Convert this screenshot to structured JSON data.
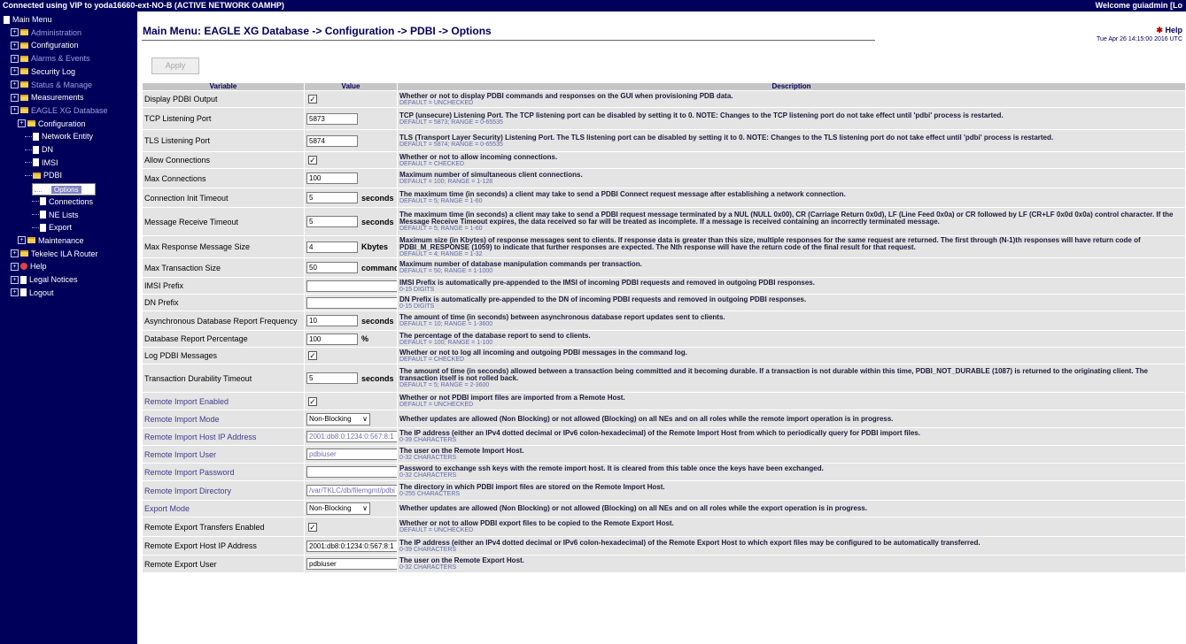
{
  "topbar": {
    "connection": "Connected using VIP to yoda16660-ext-NO-B (ACTIVE NETWORK OAMHP)",
    "welcome": "Welcome guiadmin [Lo"
  },
  "sidebar": {
    "items": [
      {
        "label": "Main Menu",
        "icon": "page-icon",
        "indent": 0
      },
      {
        "label": "Administration",
        "icon": "folder-icon",
        "indent": 1,
        "dim": true
      },
      {
        "label": "Configuration",
        "icon": "folder-icon",
        "indent": 1
      },
      {
        "label": "Alarms & Events",
        "icon": "folder-icon",
        "indent": 1,
        "dim": true
      },
      {
        "label": "Security Log",
        "icon": "folder-icon",
        "indent": 1
      },
      {
        "label": "Status & Manage",
        "icon": "folder-icon",
        "indent": 1,
        "dim": true
      },
      {
        "label": "Measurements",
        "icon": "folder-icon",
        "indent": 1
      },
      {
        "label": "EAGLE XG Database",
        "icon": "folder-icon",
        "indent": 1,
        "dim": true
      },
      {
        "label": "Configuration",
        "icon": "folder-icon",
        "indent": 2
      },
      {
        "label": "Network Entity",
        "icon": "page-icon",
        "indent": 3
      },
      {
        "label": "DN",
        "icon": "page-icon",
        "indent": 3
      },
      {
        "label": "IMSI",
        "icon": "page-icon",
        "indent": 3
      },
      {
        "label": "PDBI",
        "icon": "folder-icon",
        "indent": 3
      },
      {
        "label": "Options",
        "icon": "page-icon",
        "indent": 4,
        "selected": true
      },
      {
        "label": "Connections",
        "icon": "page-icon",
        "indent": 4
      },
      {
        "label": "NE Lists",
        "icon": "page-icon",
        "indent": 4
      },
      {
        "label": "Export",
        "icon": "page-icon",
        "indent": 4
      },
      {
        "label": "Maintenance",
        "icon": "folder-icon",
        "indent": 2
      },
      {
        "label": "Tekelec ILA Router",
        "icon": "folder-icon",
        "indent": 1
      },
      {
        "label": "Help",
        "icon": "help-icon",
        "indent": 1
      },
      {
        "label": "Legal Notices",
        "icon": "page-icon",
        "indent": 1
      },
      {
        "label": "Logout",
        "icon": "page-icon",
        "indent": 1
      }
    ]
  },
  "page": {
    "title": "Main Menu: EAGLE XG Database -> Configuration -> PDBI -> Options",
    "help": "Help",
    "timestamp": "Tue Apr 26 14:15:00 2016 UTC",
    "apply_label": "Apply"
  },
  "table": {
    "headers": {
      "variable": "Variable",
      "value": "Value",
      "description": "Description"
    },
    "rows": [
      {
        "variable": "Display PDBI Output",
        "type": "checkbox",
        "checked": true,
        "desc": "Whether or not to display PDBI commands and responses on the GUI when provisioning PDB data.",
        "meta": "DEFAULT = UNCHECKED"
      },
      {
        "variable": "TCP Listening Port",
        "type": "text",
        "value": "5873",
        "desc": "TCP (unsecure) Listening Port. The TCP listening port can be disabled by setting it to 0. NOTE: Changes to the TCP listening port do not take effect until 'pdbi' process is restarted.",
        "meta": "DEFAULT = 5873; RANGE = 0-65535"
      },
      {
        "variable": "TLS Listening Port",
        "type": "text",
        "value": "5874",
        "desc": "TLS (Transport Layer Security) Listening Port. The TLS listening port can be disabled by setting it to 0. NOTE: Changes to the TLS listening port do not take effect until 'pdbi' process is restarted.",
        "meta": "DEFAULT = 5874; RANGE = 0-65535"
      },
      {
        "variable": "Allow Connections",
        "type": "checkbox",
        "checked": true,
        "desc": "Whether or not to allow incoming connections.",
        "meta": "DEFAULT = CHECKED"
      },
      {
        "variable": "Max Connections",
        "type": "text",
        "value": "100",
        "desc": "Maximum number of simultaneous client connections.",
        "meta": "DEFAULT = 100; RANGE = 1-128"
      },
      {
        "variable": "Connection Init Timeout",
        "type": "text",
        "value": "5",
        "unit": "seconds",
        "desc": "The maximum time (in seconds) a client may take to send a PDBI Connect request message after establishing a network connection.",
        "meta": "DEFAULT = 5; RANGE = 1-60"
      },
      {
        "variable": "Message Receive Timeout",
        "type": "text",
        "value": "5",
        "unit": "seconds",
        "desc": "The maximum time (in seconds) a client may take to send a PDBI request message terminated by a NUL (NULL 0x00), CR (Carriage Return 0x0d), LF (Line Feed 0x0a) or CR followed by LF (CR+LF 0x0d 0x0a) control character. If the Message Receive Timeout expires, the data received so far will be treated as incomplete. If a message is received containing an incorrectly terminated message.",
        "meta": "DEFAULT = 5; RANGE = 1-60"
      },
      {
        "variable": "Max Response Message Size",
        "type": "text",
        "value": "4",
        "unit": "Kbytes",
        "desc": "Maximum size (in Kbytes) of response messages sent to clients. If response data is greater than this size, multiple responses for the same request are returned. The first through (N-1)th responses will have return code of PDBI_M_RESPONSE (1059) to indicate that further responses are expected. The Nth response will have the return code of the final result for that request.",
        "meta": "DEFAULT = 4; RANGE = 1-32"
      },
      {
        "variable": "Max Transaction Size",
        "type": "text",
        "value": "50",
        "unit": "commands",
        "desc": "Maximum number of database manipulation commands per transaction.",
        "meta": "DEFAULT = 50; RANGE = 1-1000"
      },
      {
        "variable": "IMSI Prefix",
        "type": "text-long",
        "value": "",
        "desc": "IMSI Prefix is automatically pre-appended to the IMSI of incoming PDBI requests and removed in outgoing PDBI responses.",
        "meta": "0-15 DIGITS"
      },
      {
        "variable": "DN Prefix",
        "type": "text-long",
        "value": "",
        "desc": "DN Prefix is automatically pre-appended to the DN of incoming PDBI requests and removed in outgoing PDBI responses.",
        "meta": "0-15 DIGITS"
      },
      {
        "variable": "Asynchronous Database Report Frequency",
        "type": "text",
        "value": "10",
        "unit": "seconds",
        "desc": "The amount of time (in seconds) between asynchronous database report updates sent to clients.",
        "meta": "DEFAULT = 10; RANGE = 1-3600"
      },
      {
        "variable": "Database Report Percentage",
        "type": "text",
        "value": "100",
        "unit": "%",
        "desc": "The percentage of the database report to send to clients.",
        "meta": "DEFAULT = 100; RANGE = 1-100"
      },
      {
        "variable": "Log PDBI Messages",
        "type": "checkbox",
        "checked": true,
        "desc": "Whether or not to log all incoming and outgoing PDBI messages in the command log.",
        "meta": "DEFAULT = CHECKED"
      },
      {
        "variable": "Transaction Durability Timeout",
        "type": "text",
        "value": "5",
        "unit": "seconds",
        "desc": "The amount of time (in seconds) allowed between a transaction being committed and it becoming durable. If a transaction is not durable within this time, PDBI_NOT_DURABLE (1087) is returned to the originating client. The transaction itself is not rolled back.",
        "meta": "DEFAULT = 5; RANGE = 2-3600"
      },
      {
        "variable": "Remote Import Enabled",
        "type": "checkbox",
        "checked": true,
        "light": true,
        "desc": "Whether or not PDBI import files are imported from a Remote Host.",
        "meta": "DEFAULT = UNCHECKED"
      },
      {
        "variable": "Remote Import Mode",
        "type": "select",
        "value": "Non-Blocking",
        "light": true,
        "desc": "Whether updates are allowed (Non Blocking) or not allowed (Blocking) on all NEs and on all roles while the remote import operation is in progress.",
        "meta": ""
      },
      {
        "variable": "Remote Import Host IP Address",
        "type": "text-long",
        "value": "2001:db8:0:1234:0:567:8:1",
        "light": true,
        "desc": "The IP address (either an IPv4 dotted decimal or IPv6 colon-hexadecimal) of the Remote Import Host from which to periodically query for PDBI import files.",
        "meta": "0-39 CHARACTERS"
      },
      {
        "variable": "Remote Import User",
        "type": "text-long",
        "value": "pdbiuser",
        "light": true,
        "desc": "The user on the Remote Import Host.",
        "meta": "0-32 CHARACTERS"
      },
      {
        "variable": "Remote Import Password",
        "type": "text-long",
        "value": "",
        "light": true,
        "desc": "Password to exchange ssh keys with the remote import host. It is cleared from this table once the keys have been exchanged.",
        "meta": "0-32 CHARACTERS"
      },
      {
        "variable": "Remote Import Directory",
        "type": "text-long",
        "value": "/var/TKLC/db/filemgmt/pdbi",
        "light": true,
        "desc": "The directory in which PDBI import files are stored on the Remote Import Host.",
        "meta": "0-255 CHARACTERS"
      },
      {
        "variable": "Export Mode",
        "type": "select",
        "value": "Non-Blocking",
        "light": true,
        "desc": "Whether updates are allowed (Non Blocking) or not allowed (Blocking) on all NEs and on all roles while the export operation is in progress.",
        "meta": ""
      },
      {
        "variable": "Remote Export Transfers Enabled",
        "type": "checkbox",
        "checked": true,
        "desc": "Whether or not to allow PDBI export files to be copied to the Remote Export Host.",
        "meta": "DEFAULT = UNCHECKED"
      },
      {
        "variable": "Remote Export Host IP Address",
        "type": "text-long",
        "value": "2001:db8:0:1234:0:567:8:1",
        "desc": "The IP address (either an IPv4 dotted decimal or IPv6 colon-hexadecimal) of the Remote Export Host to which export files may be configured to be automatically transferred.",
        "meta": "0-39 CHARACTERS"
      },
      {
        "variable": "Remote Export User",
        "type": "text-long",
        "value": "pdbiuser",
        "desc": "The user on the Remote Export Host.",
        "meta": "0-32 CHARACTERS"
      }
    ]
  }
}
